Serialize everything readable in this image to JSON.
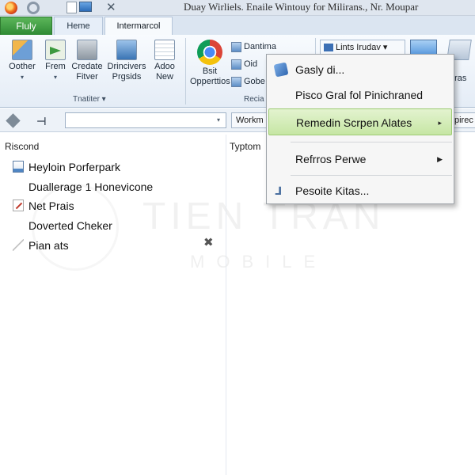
{
  "window": {
    "title": "Duay Wirliels. Enaile Wintouy for Milirans., Nr. Moupar",
    "close_glyph": "✕"
  },
  "tabs": [
    {
      "label": "Fluly"
    },
    {
      "label": "Heme"
    },
    {
      "label": "Intermarcol"
    }
  ],
  "ribbon": {
    "buttons": [
      {
        "label": "Oother"
      },
      {
        "label": "Frem"
      },
      {
        "label": "Credate Fitver"
      },
      {
        "label": "Drincivers Prgsids"
      },
      {
        "label": "Adoo New"
      }
    ],
    "group1_label": "Tnatiter ▾",
    "chrome_button": {
      "label": "Bsit Opperttios"
    },
    "small_buttons": [
      "Dantima",
      "Oid",
      "Gobe"
    ],
    "group2_label": "Recia",
    "lints": "Lints Irudav ▾",
    "right_label": "pras"
  },
  "navbar": {
    "dropdown_glyph": "▾",
    "work_button": "Workm",
    "right_button": "pirec"
  },
  "content": {
    "col1_header": "Riscond",
    "col2_header": "Typtom",
    "items": [
      {
        "label": "Heyloin Porferpark",
        "icon": "document-icon"
      },
      {
        "label": "Duallerage 1 Honevicone",
        "icon": ""
      },
      {
        "label": "Net Prais",
        "icon": "pen-icon"
      },
      {
        "label": "Doverted Cheker",
        "icon": ""
      },
      {
        "label": "Pian ats",
        "icon": "feather-icon"
      }
    ],
    "close_glyph": "✖"
  },
  "watermark": {
    "line1": "TIEN TRAN",
    "line2": "MOBILE"
  },
  "context_menu": {
    "items": [
      {
        "label": "Gasly di...",
        "icon": "gasly-icon",
        "submenu": false,
        "highlighted": false
      },
      {
        "label": "Pisco Gral fol Pinichraned",
        "icon": "",
        "submenu": false,
        "highlighted": false
      },
      {
        "label": "Remedin Scrpen Alates",
        "icon": "",
        "submenu": true,
        "highlighted": true
      },
      {
        "label": "Refrros Perwe",
        "icon": "",
        "submenu": true,
        "highlighted": false
      },
      {
        "label": "Pesoite Kitas...",
        "icon": "pin-icon",
        "submenu": false,
        "highlighted": false
      }
    ],
    "submenu_glyph": "▸",
    "submenu_glyph_dark": "▶"
  },
  "colors": {
    "file_tab": "#3f9a40",
    "menu_highlight": "#c6e6a4",
    "ribbon_bg": "#e4ecf6"
  }
}
